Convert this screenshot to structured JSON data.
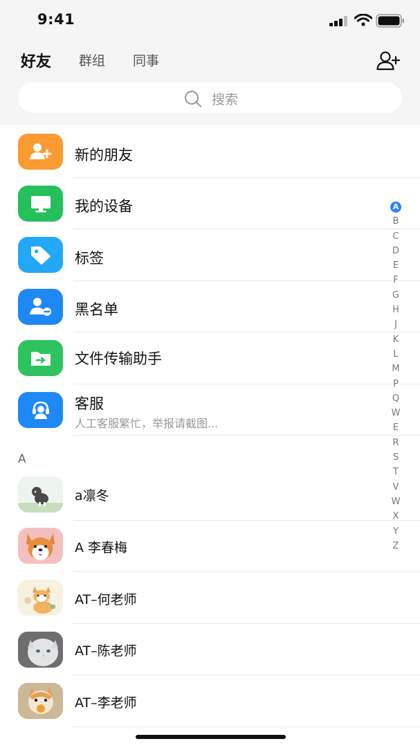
{
  "status_bar": {
    "time": "9:41"
  },
  "header": {
    "tabs": [
      {
        "label": "好友",
        "active": true
      },
      {
        "label": "群组",
        "active": false
      },
      {
        "label": "同事",
        "active": false
      }
    ],
    "add_friend_icon": "add-user-icon"
  },
  "search": {
    "placeholder": "搜索",
    "icon": "search-icon"
  },
  "functions": [
    {
      "label": "新的朋友",
      "icon": "person-add-icon",
      "color": "#FA9B32"
    },
    {
      "label": "我的设备",
      "icon": "monitor-icon",
      "color": "#25C05B"
    },
    {
      "label": "标签",
      "icon": "tag-icon",
      "color": "#23A8F7"
    },
    {
      "label": "黑名单",
      "icon": "person-block-icon",
      "color": "#1E88F5"
    },
    {
      "label": "文件传输助手",
      "icon": "folder-transfer-icon",
      "color": "#2EC35E"
    },
    {
      "label": "客服",
      "subtitle": "人工客服繁忙，举报请截图...",
      "icon": "headset-icon",
      "color": "#1E88F5"
    }
  ],
  "section_header": "A",
  "contacts": [
    {
      "name": "a凛冬",
      "avatar": "kitten-illustration-avatar"
    },
    {
      "name": "A 李春梅",
      "avatar": "corgi-avatar"
    },
    {
      "name": "AT–何老师",
      "avatar": "cat-illustration-avatar"
    },
    {
      "name": "AT–陈老师",
      "avatar": "white-cat-avatar"
    },
    {
      "name": "AT–李老师",
      "avatar": "cat-eating-avatar"
    }
  ],
  "index_letters": [
    "A",
    "B",
    "C",
    "D",
    "E",
    "F",
    "G",
    "H",
    "J",
    "K",
    "L",
    "M",
    "P",
    "Q",
    "W",
    "E",
    "R",
    "S",
    "T",
    "V",
    "W",
    "X",
    "Y",
    "Z"
  ],
  "active_index": "A"
}
